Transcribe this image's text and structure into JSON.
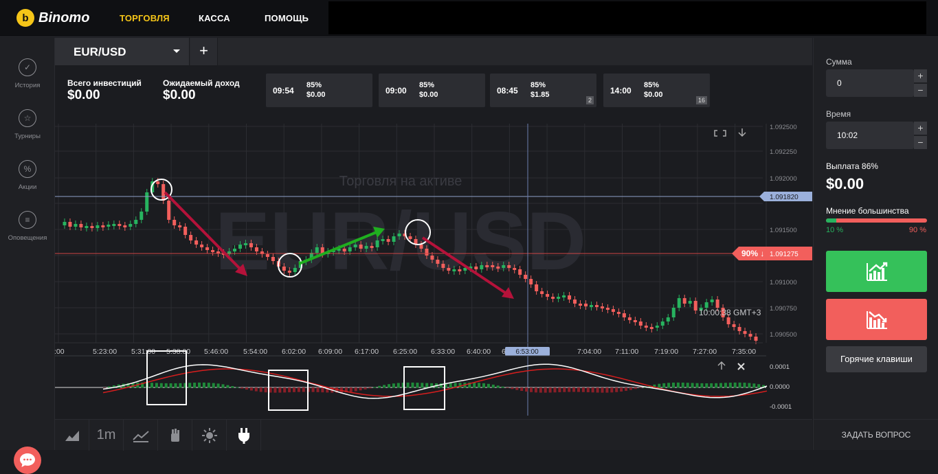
{
  "app": {
    "logo_text": "Binomo",
    "logo_mark": "b"
  },
  "nav": {
    "trading": "ТОРГОВЛЯ",
    "cashier": "КАССА",
    "help": "ПОМОЩЬ",
    "active_color": "#f5c518"
  },
  "sidebar": {
    "items": [
      {
        "label": "История",
        "icon": "check-circle-icon"
      },
      {
        "label": "Турниры",
        "icon": "trophy-icon"
      },
      {
        "label": "Акции",
        "icon": "percent-icon"
      },
      {
        "label": "Оповещения",
        "icon": "bell-list-icon"
      }
    ]
  },
  "tabs": {
    "asset": "EUR/USD",
    "add": "+"
  },
  "info": {
    "total_invest_label": "Всего инвестиций",
    "total_invest_value": "$0.00",
    "expected_label": "Ожидаемый доход",
    "expected_value": "$0.00"
  },
  "deals": [
    {
      "time": "09:54",
      "pct": "85%",
      "amount": "$0.00",
      "badge": ""
    },
    {
      "time": "09:00",
      "pct": "85%",
      "amount": "$0.00",
      "badge": ""
    },
    {
      "time": "08:45",
      "pct": "85%",
      "amount": "$1.85",
      "badge": "2"
    },
    {
      "time": "14:00",
      "pct": "85%",
      "amount": "$0.00",
      "badge": "16"
    }
  ],
  "chart": {
    "watermark_title": "Торговля на активе",
    "watermark_asset": "EUR/USD",
    "price_ticks": [
      "1.092500",
      "1.092250",
      "1.092000",
      "1.091820",
      "1.091500",
      "1.091275",
      "1.091000",
      "1.090750",
      "1.090500"
    ],
    "time_ticks": [
      ":00",
      "5:23:00",
      "5:31:00",
      "5:38:00",
      "5:46:00",
      "5:54:00",
      "6:02:00",
      "6:09:00",
      "6:17:00",
      "6:25:00",
      "6:33:00",
      "6:40:00",
      "6:48",
      "6:53:00",
      "7:04:00",
      "7:11:00",
      "7:19:00",
      "7:27:00",
      "7:35:00"
    ],
    "current_price_label": "1.091820",
    "majority_price": "1.091275",
    "majority_pct": "90% ↓",
    "cursor_time": "6:53:00",
    "clock": "10:00:38 GMT+3",
    "osc_ticks": [
      "0.0001",
      "0.0000",
      "-0.0001"
    ],
    "up_color": "#27b35f",
    "down_color": "#f25f5c"
  },
  "toolbar": {
    "timeframe": "1m"
  },
  "right": {
    "sum_label": "Сумма",
    "sum_value": "0",
    "time_label": "Время",
    "time_value": "10:02",
    "payout_label": "Выплата 86%",
    "payout_value": "$0.00",
    "majority_label": "Мнение большинства",
    "majority_up": "10 %",
    "majority_down": "90 %",
    "majority_up_fraction": 0.1,
    "hotkeys": "Горячие клавиши",
    "ask": "ЗАДАТЬ ВОПРОС",
    "plus": "+",
    "minus": "−"
  }
}
